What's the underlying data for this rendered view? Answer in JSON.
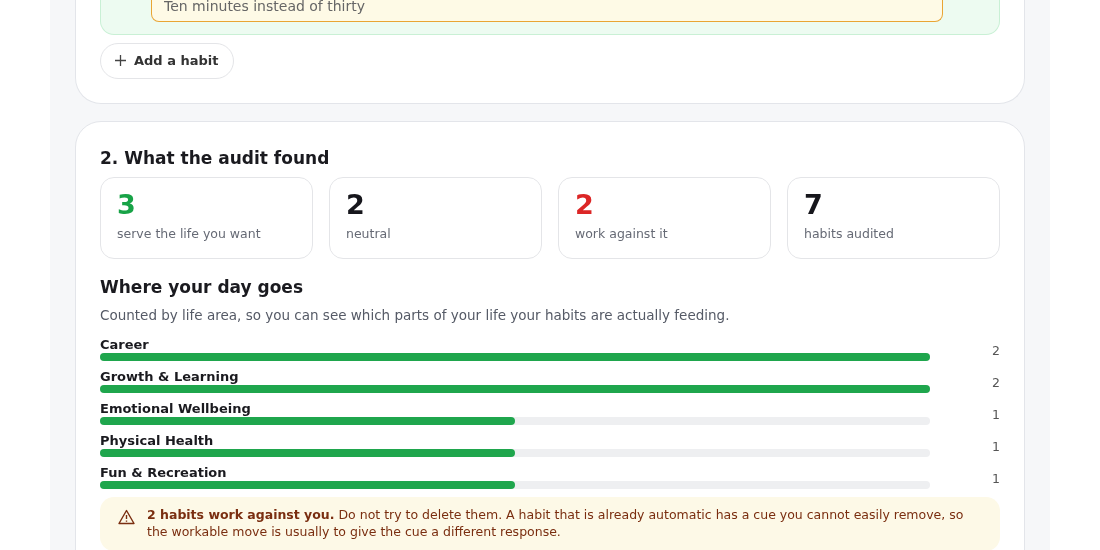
{
  "habit_card": {
    "answer_value": "Ten minutes instead of thirty",
    "add_button": "Add a habit"
  },
  "audit": {
    "title": "2. What the audit found",
    "stats": [
      {
        "value": "3",
        "label": "serve the life you want",
        "kind": "good"
      },
      {
        "value": "2",
        "label": "neutral",
        "kind": "neutral"
      },
      {
        "value": "2",
        "label": "work against it",
        "kind": "bad"
      },
      {
        "value": "7",
        "label": "habits audited",
        "kind": "neutral"
      }
    ],
    "areas_title": "Where your day goes",
    "areas_subtitle": "Counted by life area, so you can see which parts of your life your habits are actually feeding.",
    "areas": [
      {
        "name": "Career",
        "level": 1,
        "count": "2"
      },
      {
        "name": "Growth & Learning",
        "level": 1,
        "count": "2"
      },
      {
        "name": "Emotional Wellbeing",
        "level": 0.5,
        "count": "1"
      },
      {
        "name": "Physical Health",
        "level": 0.5,
        "count": "1"
      },
      {
        "name": "Fun & Recreation",
        "level": 0.5,
        "count": "1"
      }
    ],
    "warning": "**2 habits work against you.** Do not try to delete them. A habit that is already automatic has a cue you cannot easily remove, so the workable move is usually to give the cue a different response."
  }
}
